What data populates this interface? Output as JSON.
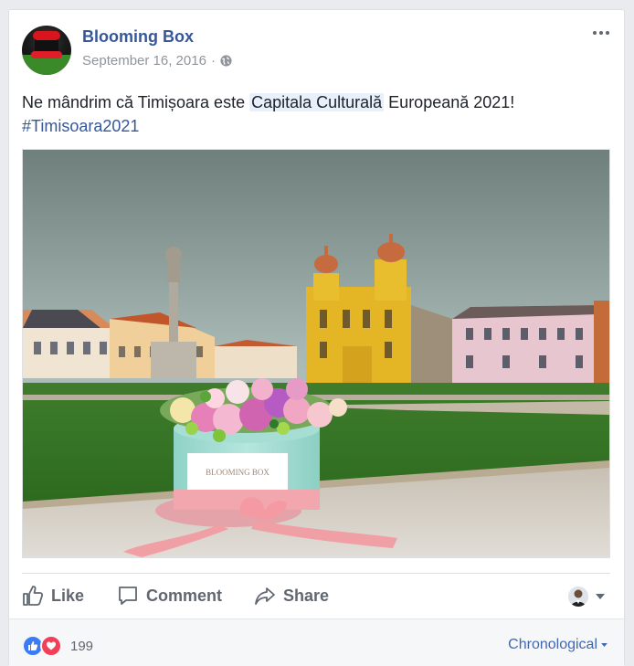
{
  "post": {
    "page_name": "Blooming Box",
    "date": "September 16, 2016",
    "separator": "·",
    "privacy_icon": "globe-icon",
    "more_icon": "ellipsis-icon",
    "text_before": "Ne mândrim că Timișoara este ",
    "text_link": "Capitala Culturală",
    "text_after": " Europeană 2021!",
    "hashtag": "#Timisoara2021",
    "photo_brand": "BLOOMING BOX"
  },
  "actions": {
    "like": "Like",
    "comment": "Comment",
    "share": "Share"
  },
  "footer": {
    "reaction_icons": [
      "like-icon",
      "love-icon"
    ],
    "reaction_count": "199",
    "sort_label": "Chronological"
  },
  "colors": {
    "link": "#365899",
    "secondary_text": "#90949c",
    "action_text": "#606770",
    "like_blue": "#3b7cf6",
    "love_red": "#f33e58"
  }
}
